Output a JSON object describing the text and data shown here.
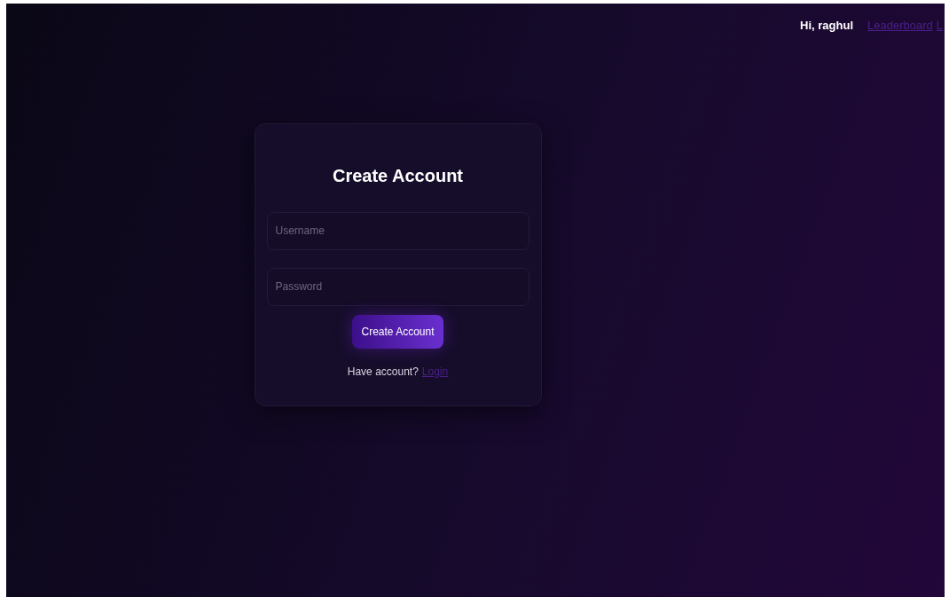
{
  "nav": {
    "greeting": "Hi, raghul",
    "links": [
      "Leaderboard",
      "L"
    ]
  },
  "form": {
    "title": "Create Account",
    "fields": [
      {
        "placeholder": "Username"
      },
      {
        "placeholder": "Password"
      }
    ],
    "submit": "Create Account",
    "prompt": "Have account?",
    "link": "Login"
  }
}
